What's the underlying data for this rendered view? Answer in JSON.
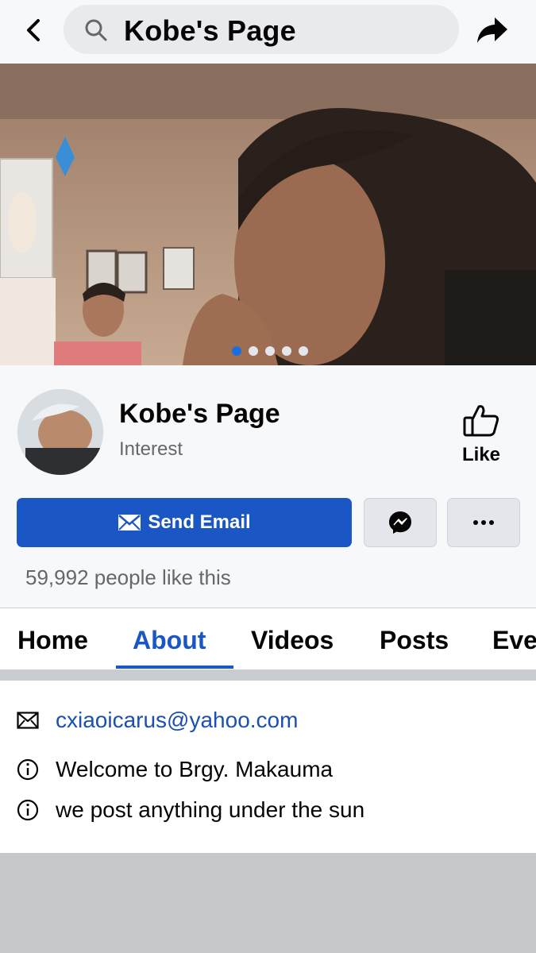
{
  "header": {
    "back_icon": "chevron-left-icon",
    "search_icon": "search-icon",
    "title": "Kobe's Page",
    "share_icon": "share-arrow-icon"
  },
  "cover": {
    "carousel_total": 5,
    "carousel_active_index": 0
  },
  "profile": {
    "name": "Kobe's Page",
    "category": "Interest",
    "like_label": "Like",
    "like_icon": "thumbs-up-icon"
  },
  "actions": {
    "send_email_label": "Send Email",
    "send_email_icon": "envelope-icon",
    "messenger_icon": "messenger-icon",
    "more_icon": "more-dots-icon"
  },
  "likes_text": "59,992 people like this",
  "tabs": [
    {
      "label": "Home",
      "active": false
    },
    {
      "label": "About",
      "active": true
    },
    {
      "label": "Videos",
      "active": false
    },
    {
      "label": "Posts",
      "active": false
    },
    {
      "label": "Eve",
      "active": false
    }
  ],
  "about": {
    "email": "cxiaoicarus@yahoo.com",
    "info_lines": [
      "Welcome to Brgy. Makauma",
      "we post anything under the sun"
    ]
  },
  "colors": {
    "accent": "#1b57c4",
    "carousel_active": "#1b6ede",
    "link": "#1b4fb3",
    "muted_text": "#65676b"
  }
}
